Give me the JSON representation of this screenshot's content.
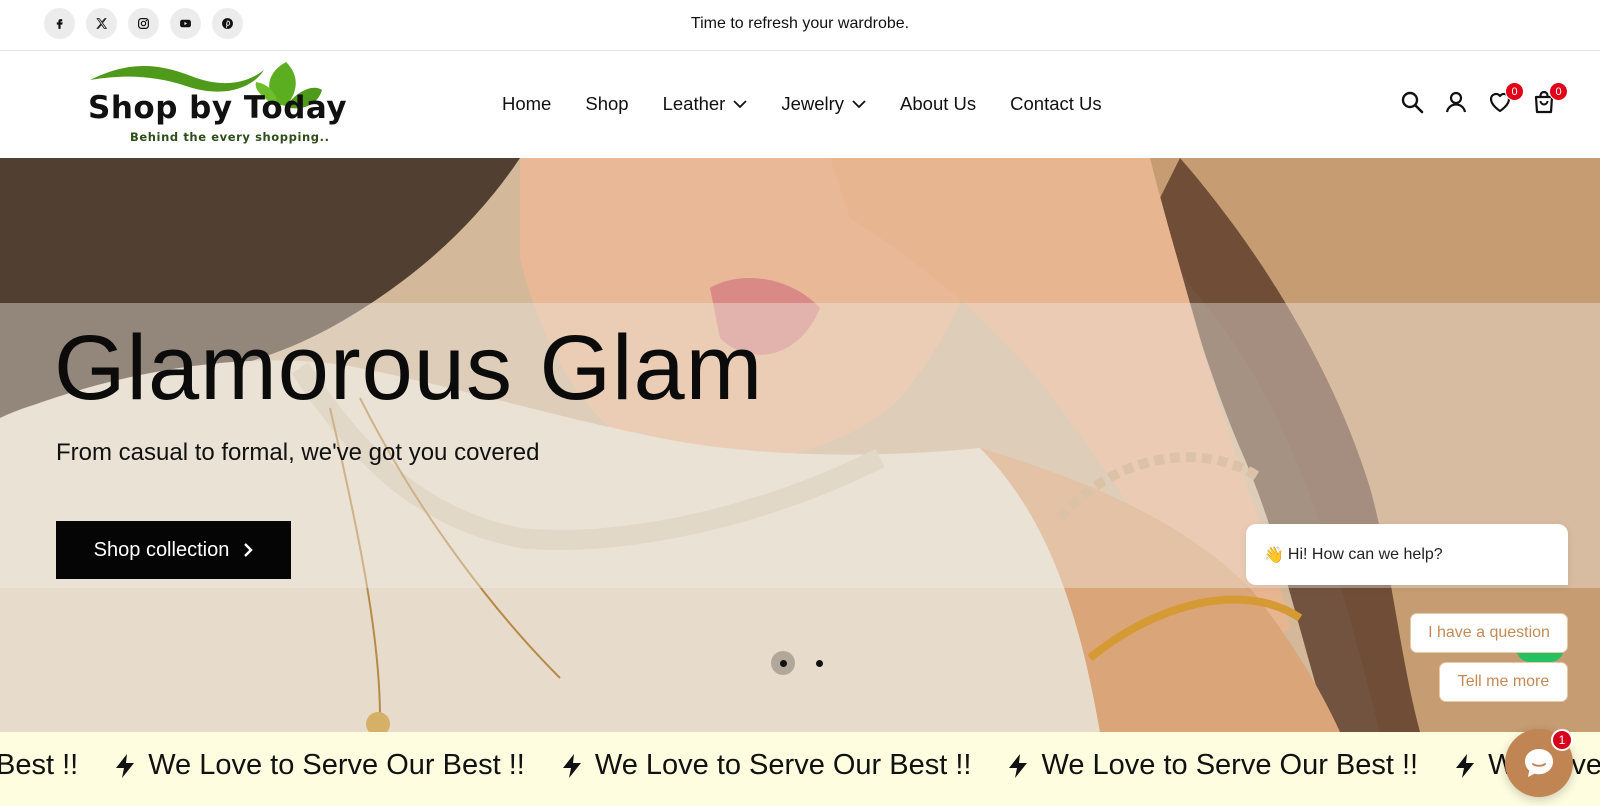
{
  "announcement": {
    "text": "Time to refresh your wardrobe."
  },
  "socials": [
    {
      "name": "facebook-icon"
    },
    {
      "name": "x-icon"
    },
    {
      "name": "instagram-icon"
    },
    {
      "name": "youtube-icon"
    },
    {
      "name": "pinterest-icon"
    }
  ],
  "logo": {
    "name": "Shop by Today",
    "tagline": "Behind the every shopping.."
  },
  "nav": {
    "home": "Home",
    "shop": "Shop",
    "leather": "Leather",
    "jewelry": "Jewelry",
    "about": "About Us",
    "contact": "Contact Us"
  },
  "header_icons": {
    "wishlist_count": "0",
    "cart_count": "0"
  },
  "hero": {
    "title": "Glamorous Glam",
    "subtitle": "From casual to formal, we've got you covered",
    "cta": "Shop collection",
    "slides": 2,
    "active_slide": 1
  },
  "chat": {
    "greeting_emoji": "👋",
    "greeting": "Hi! How can we help?",
    "option1": "I have a question",
    "option2": "Tell me more",
    "unread": "1"
  },
  "marquee": {
    "partial_start": "Best !!",
    "message": "We Love to Serve Our Best !!",
    "partial_end": "We Love to Se"
  },
  "colors": {
    "accent_chat": "#c08552",
    "badge_red": "#e1051a",
    "marquee_bg": "#fffde0",
    "button_bg": "#050505"
  }
}
